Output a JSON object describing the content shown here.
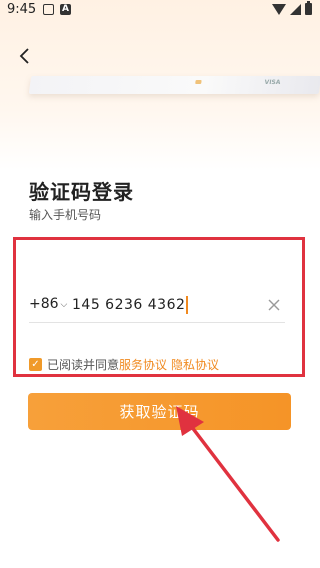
{
  "status_bar": {
    "time": "9:45",
    "notif_icons": [
      "box-icon",
      "a-icon"
    ]
  },
  "header": {
    "back_icon": "chevron-left-icon"
  },
  "login": {
    "title": "验证码登录",
    "subtitle": "输入手机号码",
    "country_code": "+86",
    "phone_value": "145 6236 4362",
    "agree_prefix": "已阅读并同意",
    "service_link": "服务协议",
    "privacy_link": "隐私协议",
    "agree_checked": true,
    "submit_label": "获取验证码"
  },
  "colors": {
    "accent": "#f59427",
    "highlight": "#e0323f"
  }
}
